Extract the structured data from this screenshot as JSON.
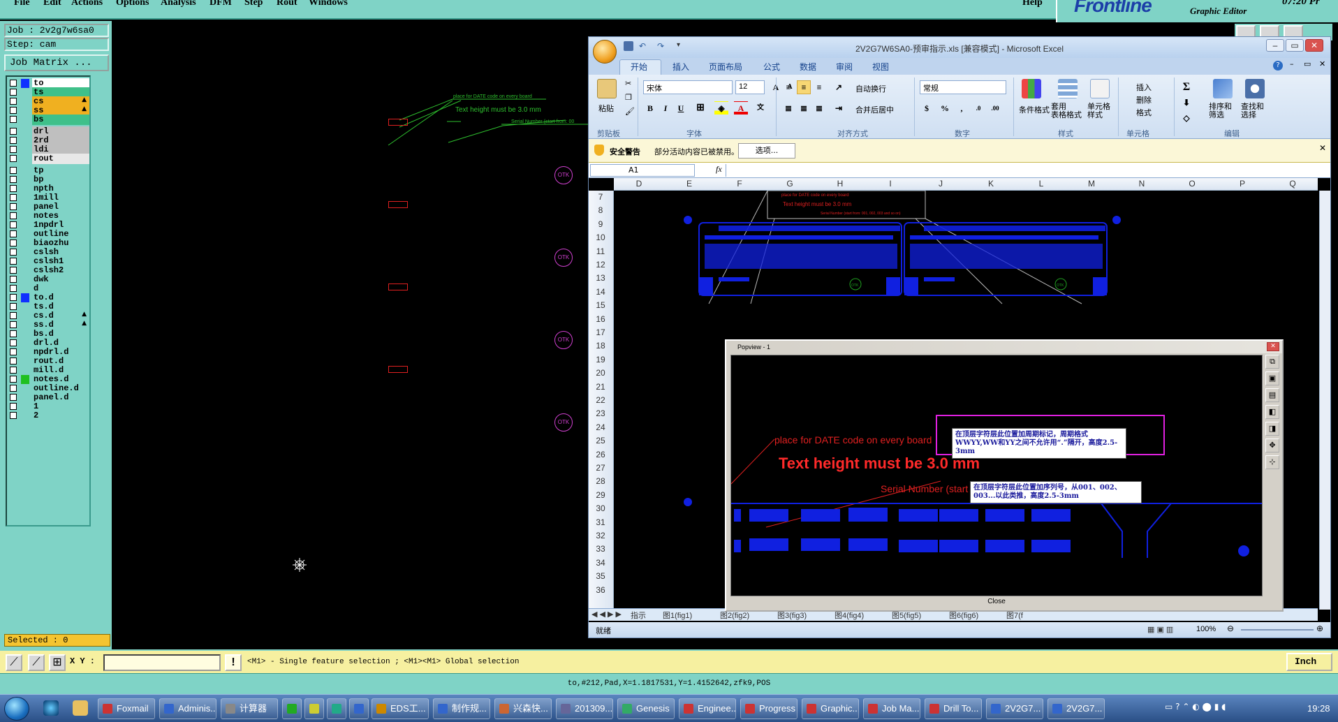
{
  "menubar": {
    "items": [
      "File",
      "Edit",
      "Actions",
      "Options",
      "Analysis",
      "DFM",
      "Step",
      "Rout",
      "Windows"
    ],
    "help": "Help",
    "brand": "Frontline",
    "brand_sub": "Graphic Editor",
    "time": "07:20 Pr"
  },
  "job": {
    "job_label": "Job : 2v2g7w6sa0",
    "step_label": "Step: cam",
    "matrix_button": "Job Matrix ..."
  },
  "layers": [
    {
      "name": "to",
      "color": "#ffffff",
      "mark": "",
      "sel": "#1030ff"
    },
    {
      "name": "ts",
      "color": "#3fc08a",
      "mark": ""
    },
    {
      "name": "cs",
      "color": "#f0b020",
      "mark": "▲"
    },
    {
      "name": "ss",
      "color": "#f0b020",
      "mark": "▲"
    },
    {
      "name": "bs",
      "color": "#3fc08a",
      "mark": ""
    },
    {
      "name": "drl",
      "color": "#bfbfbf",
      "mark": ""
    },
    {
      "name": "2rd",
      "color": "#bfbfbf",
      "mark": ""
    },
    {
      "name": "ldi",
      "color": "#bfbfbf",
      "mark": ""
    },
    {
      "name": "rout",
      "color": "#e8e8e8",
      "mark": ""
    },
    {
      "name": "tp",
      "color": "#7fd3c6",
      "mark": ""
    },
    {
      "name": "bp",
      "color": "#7fd3c6",
      "mark": ""
    },
    {
      "name": "npth",
      "color": "#7fd3c6",
      "mark": ""
    },
    {
      "name": "1mill",
      "color": "#7fd3c6",
      "mark": ""
    },
    {
      "name": "panel",
      "color": "#7fd3c6",
      "mark": ""
    },
    {
      "name": "notes",
      "color": "#7fd3c6",
      "mark": ""
    },
    {
      "name": "1npdrl",
      "color": "#7fd3c6",
      "mark": ""
    },
    {
      "name": "outline",
      "color": "#7fd3c6",
      "mark": ""
    },
    {
      "name": "biaozhu",
      "color": "#7fd3c6",
      "mark": ""
    },
    {
      "name": "cslsh",
      "color": "#7fd3c6",
      "mark": ""
    },
    {
      "name": "cslsh1",
      "color": "#7fd3c6",
      "mark": ""
    },
    {
      "name": "cslsh2",
      "color": "#7fd3c6",
      "mark": ""
    },
    {
      "name": "dwk",
      "color": "#7fd3c6",
      "mark": ""
    },
    {
      "name": "d",
      "color": "#7fd3c6",
      "mark": ""
    },
    {
      "name": "to.d",
      "color": "#7fd3c6",
      "mark": "",
      "sel": "#1030ff"
    },
    {
      "name": "ts.d",
      "color": "#7fd3c6",
      "mark": ""
    },
    {
      "name": "cs.d",
      "color": "#7fd3c6",
      "mark": "▲"
    },
    {
      "name": "ss.d",
      "color": "#7fd3c6",
      "mark": "▲"
    },
    {
      "name": "bs.d",
      "color": "#7fd3c6",
      "mark": ""
    },
    {
      "name": "drl.d",
      "color": "#7fd3c6",
      "mark": ""
    },
    {
      "name": "npdrl.d",
      "color": "#7fd3c6",
      "mark": ""
    },
    {
      "name": "rout.d",
      "color": "#7fd3c6",
      "mark": ""
    },
    {
      "name": "mill.d",
      "color": "#7fd3c6",
      "mark": ""
    },
    {
      "name": "notes.d",
      "color": "#7fd3c6",
      "mark": "",
      "sel": "#20c020"
    },
    {
      "name": "outline.d",
      "color": "#7fd3c6",
      "mark": ""
    },
    {
      "name": "panel.d",
      "color": "#7fd3c6",
      "mark": ""
    },
    {
      "name": "1",
      "color": "#7fd3c6",
      "mark": ""
    },
    {
      "name": "2",
      "color": "#7fd3c6",
      "mark": ""
    }
  ],
  "selected": "Selected : 0",
  "cmd": {
    "xy_label": "X Y :",
    "hint": "<M1> - Single feature selection ; <M1><M1> Global selection",
    "units": "Inch"
  },
  "status": "to,#212,Pad,X=1.1817531,Y=1.4152642,zfk9,POS",
  "canvas": {
    "note1": "place for DATE code on every board",
    "note2": "Text height must be 3.0  mm",
    "note3": "Serial Number (start from: 00",
    "otk": "OTK"
  },
  "excel": {
    "title": "2V2G7W6SA0-预审指示.xls  [兼容模式] - Microsoft Excel",
    "tabs": [
      "开始",
      "插入",
      "页面布局",
      "公式",
      "数据",
      "审阅",
      "视图"
    ],
    "font_name": "宋体",
    "font_size": "12",
    "paste": "粘贴",
    "clipboard": "剪贴板",
    "font_group": "字体",
    "align_group": "对齐方式",
    "wrap": "自动换行",
    "merge": "合并后居中",
    "number_format": "常规",
    "number_group": "数字",
    "cond_fmt": "条件格式",
    "table_fmt": "套用\n表格格式",
    "cell_style": "单元格\n样式",
    "style_group": "样式",
    "insert": "插入",
    "delete": "删除",
    "format": "格式",
    "cells_group": "单元格",
    "sort": "排序和\n筛选",
    "find": "查找和\n选择",
    "edit_group": "编辑",
    "sec_title": "安全警告",
    "sec_msg": "部分活动内容已被禁用。",
    "sec_btn": "选项...",
    "namebox": "A1",
    "columns": [
      "D",
      "E",
      "F",
      "G",
      "H",
      "I",
      "J",
      "K",
      "L",
      "M",
      "N",
      "O",
      "P",
      "Q"
    ],
    "rows": [
      "7",
      "8",
      "9",
      "10",
      "11",
      "12",
      "13",
      "14",
      "15",
      "16",
      "17",
      "18",
      "19",
      "20",
      "21",
      "22",
      "23",
      "24",
      "25",
      "26",
      "27",
      "28",
      "29",
      "30",
      "31",
      "32",
      "33",
      "34",
      "35",
      "36"
    ],
    "sheets": [
      "指示",
      "图1(fig1)",
      "图2(fig2)",
      "图3(fig3)",
      "图4(fig4)",
      "图5(fig5)",
      "图6(fig6)",
      "图7(f"
    ],
    "ready": "就绪",
    "zoom": "100%",
    "grid_note1": "place for DATE code on every board",
    "grid_note2": "Text height must be 3.0 mm",
    "grid_note3": "Serial Number (start from: 001, 002, 003 and so on)",
    "otk": "OTK"
  },
  "popview": {
    "title": "Popview - 1",
    "note1": "place for DATE code on every board",
    "note2": "Text height must be 3.0  mm",
    "note3": "Serial Number (start from: 001, 002, 003 and so on)",
    "cn1": "在顶层字符层此位置加周期标记，周期格式WWYY,WW和YY之间不允许用“.”隔开，高度2.5-3mm",
    "cn2": "在顶层字符层此位置加序列号，从001、002、003...以此类推，高度2.5-3mm",
    "close": "Close"
  },
  "taskbar": {
    "tasks": [
      "Foxmail",
      "Adminis...",
      "计算器",
      "",
      "",
      "",
      "",
      "EDS工...",
      "制作规...",
      "兴森快...",
      "201309...",
      "Genesis",
      "Enginee...",
      "Progress",
      "Graphic...",
      "Job Ma...",
      "Drill To...",
      "2V2G7...",
      "2V2G7..."
    ],
    "clock": "19:28"
  }
}
